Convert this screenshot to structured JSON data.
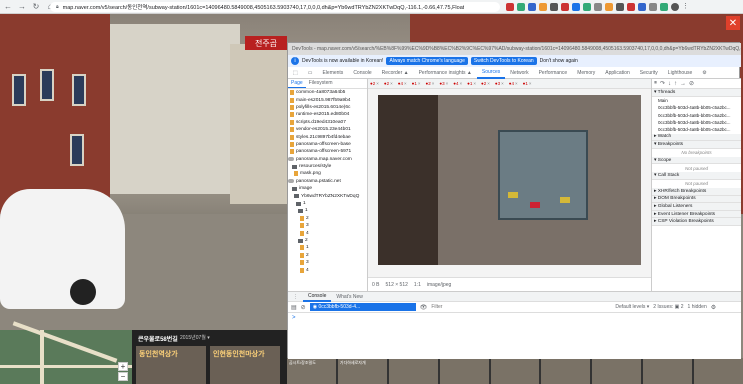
{
  "browser": {
    "url": "map.naver.com/v5/search/동인천역/subway-station/1601c=14096480.5849008,4505163.5903740,17,0,0,0,dh&p=Yb6wdTRYbZN2XKTwDqQ,-116.1,-0.66,47.75,Float"
  },
  "streetview": {
    "sign_text": "전주곱",
    "close_label": "✕"
  },
  "map_panel": {
    "zoom_in": "+",
    "zoom_out": "−"
  },
  "info_panel": {
    "title": "큰우물로58번길",
    "date": "2015년07월 ▾",
    "thumb1": "동인천역상가",
    "thumb2": "인현동인천마상가"
  },
  "filmstrip": [
    "곰시트/장조밀도",
    "가다하세로자개",
    "",
    "",
    "",
    "",
    "",
    "",
    ""
  ],
  "devtools": {
    "title_url": "DevTools - map.naver.com/v5/search/%EB%8F%99%EC%9D%B8%EC%B2%9C%EC%97%AD/subway-station/1601c=14096480.5849008,4505163.5903740,17,0,0,0,dh&p=Yb6wdTRYbZN2XKTwDqQ,-116.1,-0.66,47.75,Float",
    "notice": {
      "text": "DevTools is now available in Korean!",
      "btn1": "Always match Chrome's language",
      "btn2": "Switch DevTools to Korean",
      "link": "Don't show again"
    },
    "tabs": [
      "Elements",
      "Console",
      "Recorder ▲",
      "Performance insights ▲",
      "Sources",
      "Network",
      "Performance",
      "Memory",
      "Application",
      "Security",
      "Lighthouse"
    ],
    "active_tab": "Sources",
    "left_tabs": [
      "Page",
      "Filesystem"
    ],
    "tree": [
      {
        "kind": "file",
        "label": "common-4a8073a64b5"
      },
      {
        "kind": "file",
        "label": "main-es2015.987f59a9b4"
      },
      {
        "kind": "file",
        "label": "polyfills-es2015.6014e)6c"
      },
      {
        "kind": "file",
        "label": "runtime-es2015.ed80b04"
      },
      {
        "kind": "file",
        "label": "scripts.d19ed4310ea07"
      },
      {
        "kind": "file",
        "label": "vendor-es2015.23e44b01"
      },
      {
        "kind": "file",
        "label": "styles.21c9897b4fd4ebae"
      },
      {
        "kind": "file",
        "label": "panorama-offscreen-base"
      },
      {
        "kind": "file",
        "label": "panorama-offscreen-5971"
      },
      {
        "kind": "cloud",
        "label": "panorama.map.naver.com"
      },
      {
        "kind": "folder",
        "label": "resources/style"
      },
      {
        "kind": "file",
        "label": "mask.png"
      },
      {
        "kind": "cloud",
        "label": "panorama.pstatic.net"
      },
      {
        "kind": "folder",
        "label": "image"
      },
      {
        "kind": "folder",
        "label": "Yb6wdTRYbZN2XKTwDqQ"
      },
      {
        "kind": "folder",
        "label": "1"
      },
      {
        "kind": "folder",
        "label": "1"
      },
      {
        "kind": "file",
        "label": "2"
      },
      {
        "kind": "file",
        "label": "3"
      },
      {
        "kind": "file",
        "label": "4"
      },
      {
        "kind": "folder",
        "label": "2"
      },
      {
        "kind": "file",
        "label": "1"
      },
      {
        "kind": "file",
        "label": "2"
      },
      {
        "kind": "file",
        "label": "3"
      },
      {
        "kind": "file",
        "label": "4"
      }
    ],
    "file_tabs": [
      "2",
      "2",
      "4",
      "1",
      "2",
      "3",
      "4",
      "1",
      "2",
      "3",
      "4",
      "1"
    ],
    "image_status": {
      "zoom": "0 B",
      "size": "512 × 512",
      "ratio": "1:1",
      "mime": "image/jpeg"
    },
    "debugger": {
      "sections": [
        {
          "head": "▾ Threads",
          "rows": [
            "Main",
            "0cc3bbfb-503d-4a8b-bb05-c5a2bc...",
            "0cc3bbfb-503d-4a8b-bb05-c5a2bc...",
            "0cc3bbfb-503d-4a8b-bb05-c5a2bc...",
            "0cc3bbfb-503d-4a8b-bb05-c5a2bc..."
          ]
        },
        {
          "head": "▸ Watch",
          "rows": []
        },
        {
          "head": "▾ Breakpoints",
          "rows": [],
          "muted": "No breakpoints"
        },
        {
          "head": "▾ Scope",
          "rows": [],
          "muted": "Not paused"
        },
        {
          "head": "▾ Call Stack",
          "rows": [],
          "muted": "Not paused"
        },
        {
          "head": "▸ XHR/fetch Breakpoints",
          "rows": []
        },
        {
          "head": "▸ DOM Breakpoints",
          "rows": []
        },
        {
          "head": "▸ Global Listeners",
          "rows": []
        },
        {
          "head": "▸ Event Listener Breakpoints",
          "rows": []
        },
        {
          "head": "▸ CSP Violation Breakpoints",
          "rows": []
        }
      ]
    },
    "console": {
      "tabs": [
        "Console",
        "What's New"
      ],
      "context": "◉ 0cc3bbfb-503d-4...",
      "filter_placeholder": "Filter",
      "levels": "Default levels ▾",
      "issues": "2 Issues: ▣ 2",
      "hidden": "1 hidden",
      "prompt": ">"
    }
  }
}
